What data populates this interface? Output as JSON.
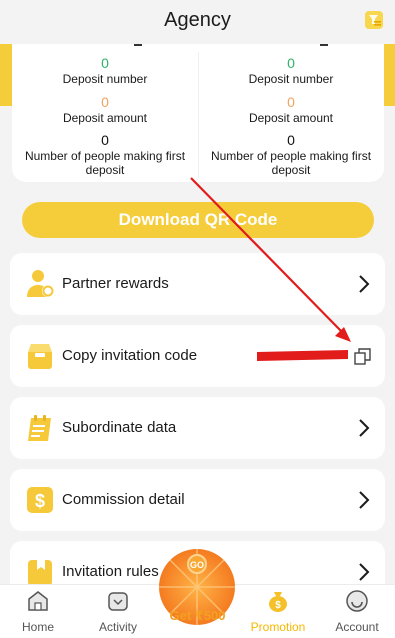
{
  "header": {
    "title": "Agency",
    "action_icon": "report-icon"
  },
  "stats": {
    "left": [
      {
        "value": "0",
        "label": "Deposit number",
        "color": "#2fb36a"
      },
      {
        "value": "0",
        "label": "Deposit amount",
        "color": "#f0a35e"
      },
      {
        "value": "0",
        "label": "Number of people making first deposit",
        "color": "#111111"
      }
    ],
    "right": [
      {
        "value": "0",
        "label": "Deposit number",
        "color": "#2fb36a"
      },
      {
        "value": "0",
        "label": "Deposit amount",
        "color": "#f0a35e"
      },
      {
        "value": "0",
        "label": "Number of people making first deposit",
        "color": "#111111"
      }
    ]
  },
  "download_button": {
    "label": "Download QR Code"
  },
  "menu": [
    {
      "label": "Partner rewards",
      "icon": "partner-icon",
      "action": "chevron"
    },
    {
      "label": "Copy invitation code",
      "icon": "inbox-icon",
      "action": "copy"
    },
    {
      "label": "Subordinate data",
      "icon": "clipboard-icon",
      "action": "chevron"
    },
    {
      "label": "Commission detail",
      "icon": "dollar-icon",
      "action": "chevron"
    },
    {
      "label": "Invitation rules",
      "icon": "bookmark-icon",
      "action": "chevron"
    }
  ],
  "bottom_nav": {
    "items": [
      {
        "label": "Home",
        "icon": "home-icon",
        "active": false
      },
      {
        "label": "Activity",
        "icon": "gift-icon",
        "active": false
      },
      {
        "label": "Promotion",
        "icon": "money-bag-icon",
        "active": true
      },
      {
        "label": "Account",
        "icon": "profile-icon",
        "active": false
      }
    ],
    "spin": {
      "label": "Get ₹500",
      "icon": "wheel-icon"
    }
  },
  "colors": {
    "accent": "#f5cd3a",
    "active_nav": "#f5b800",
    "annotation": "#e21b1b"
  }
}
